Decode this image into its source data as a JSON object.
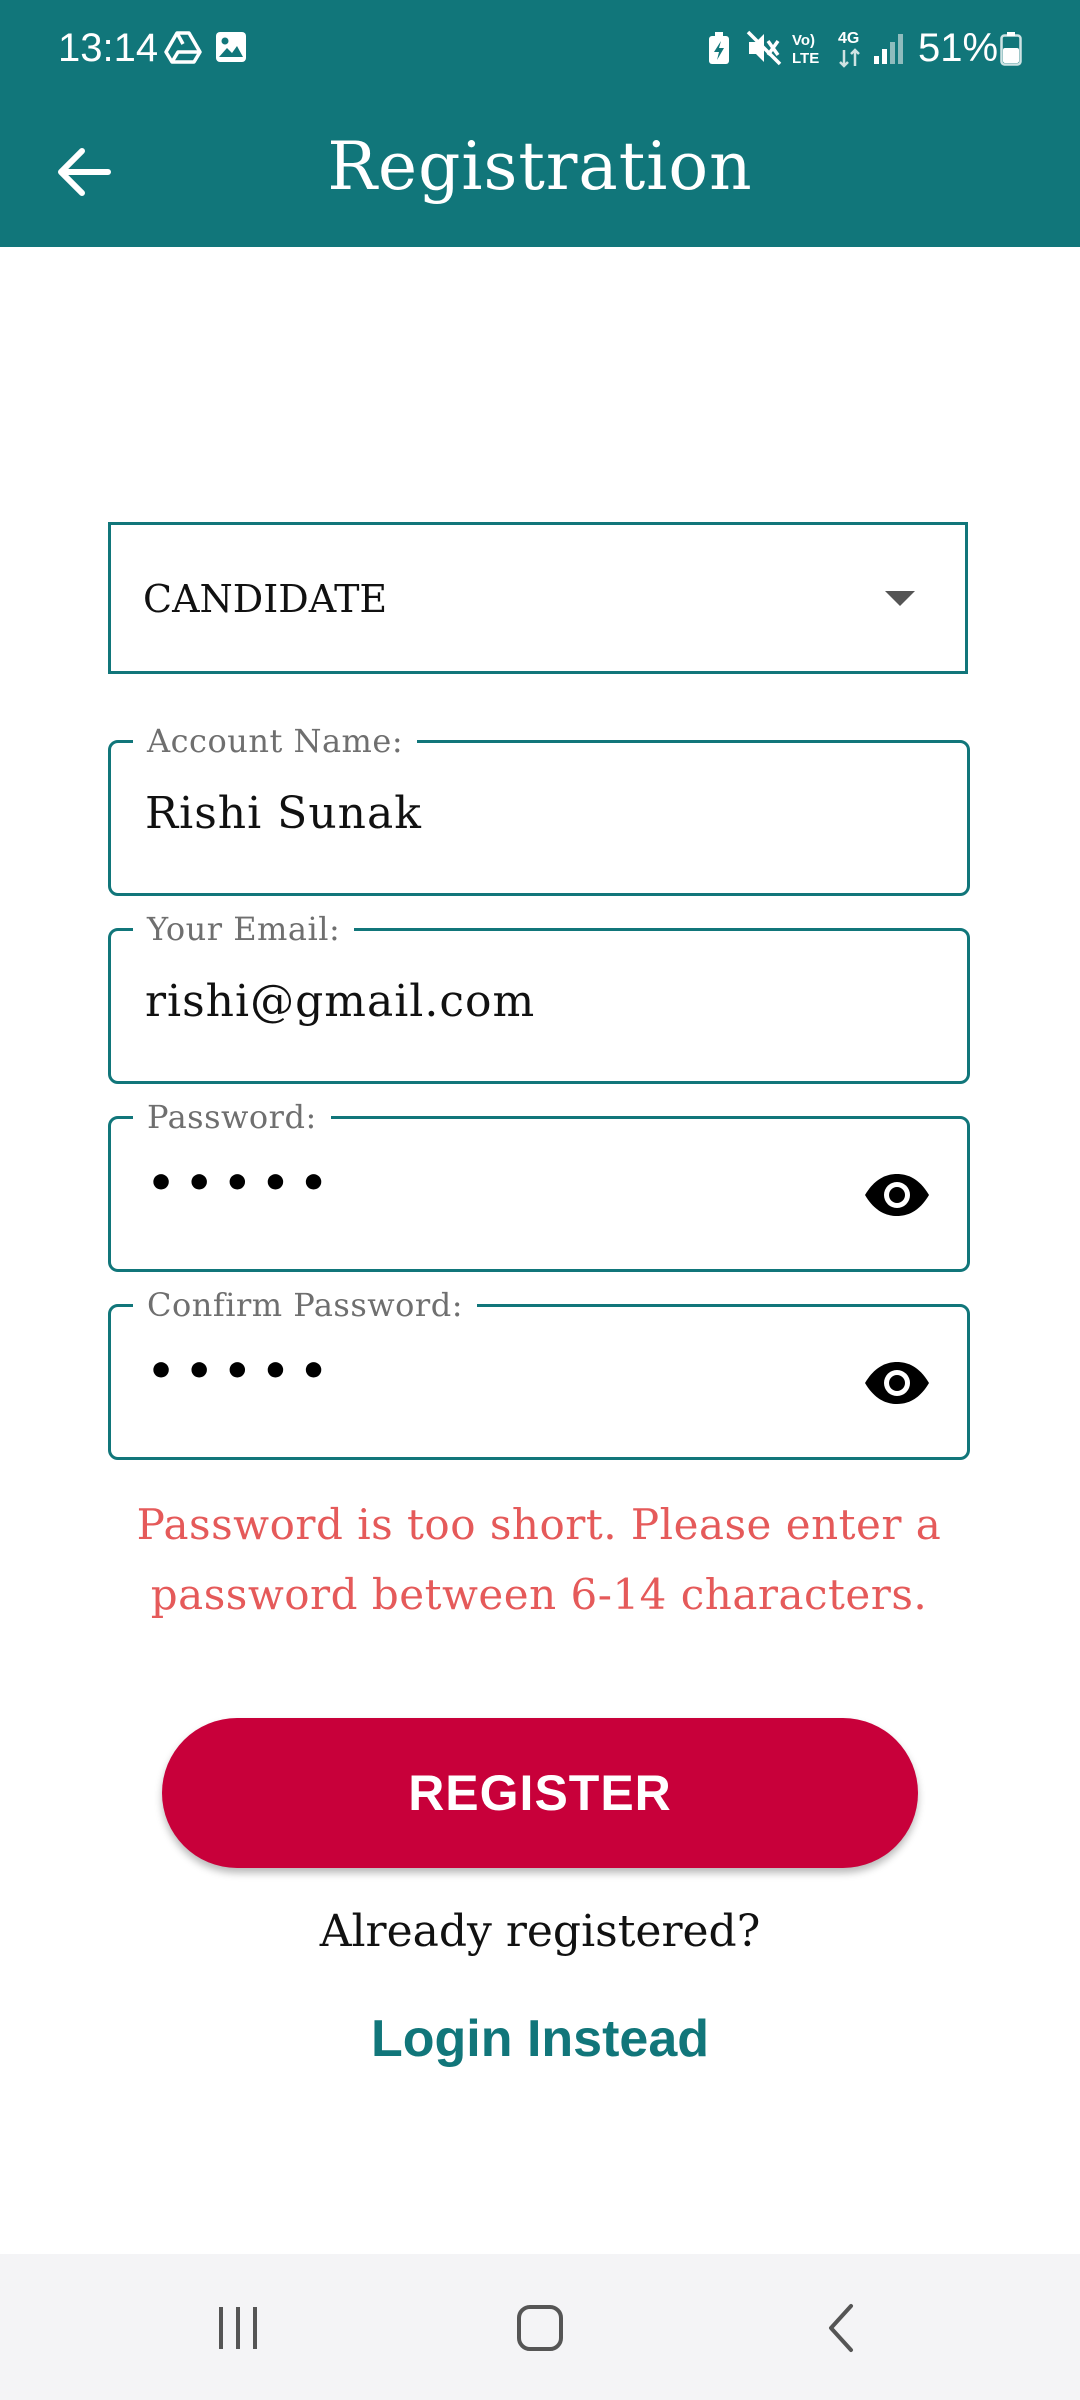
{
  "status_bar": {
    "time": "13:14",
    "battery": "51%",
    "icons": [
      "drive-icon",
      "image-icon",
      "battery-saver-icon",
      "mute-icon",
      "volte-icon",
      "4g-icon",
      "signal-icon",
      "battery-icon"
    ]
  },
  "app_bar": {
    "title": "Registration",
    "back_icon": "back-arrow-icon"
  },
  "form": {
    "role": {
      "selected": "CANDIDATE"
    },
    "account_name": {
      "label": "Account Name:",
      "value": "Rishi Sunak"
    },
    "email": {
      "label": "Your Email:",
      "value": "rishi@gmail.com"
    },
    "password": {
      "label": "Password:",
      "masked_value": "•••••"
    },
    "confirm_password": {
      "label": "Confirm Password:",
      "masked_value": "•••••"
    },
    "error": "Password is too short. Please enter a password between 6-14 characters."
  },
  "actions": {
    "register_label": "REGISTER",
    "already_registered": "Already registered?",
    "login_label": "Login Instead"
  },
  "nav_bar": {
    "buttons": [
      "recents-icon",
      "home-icon",
      "back-icon"
    ]
  },
  "colors": {
    "primary": "#11767a",
    "accent": "#c8003a",
    "error": "#e55a5a"
  }
}
